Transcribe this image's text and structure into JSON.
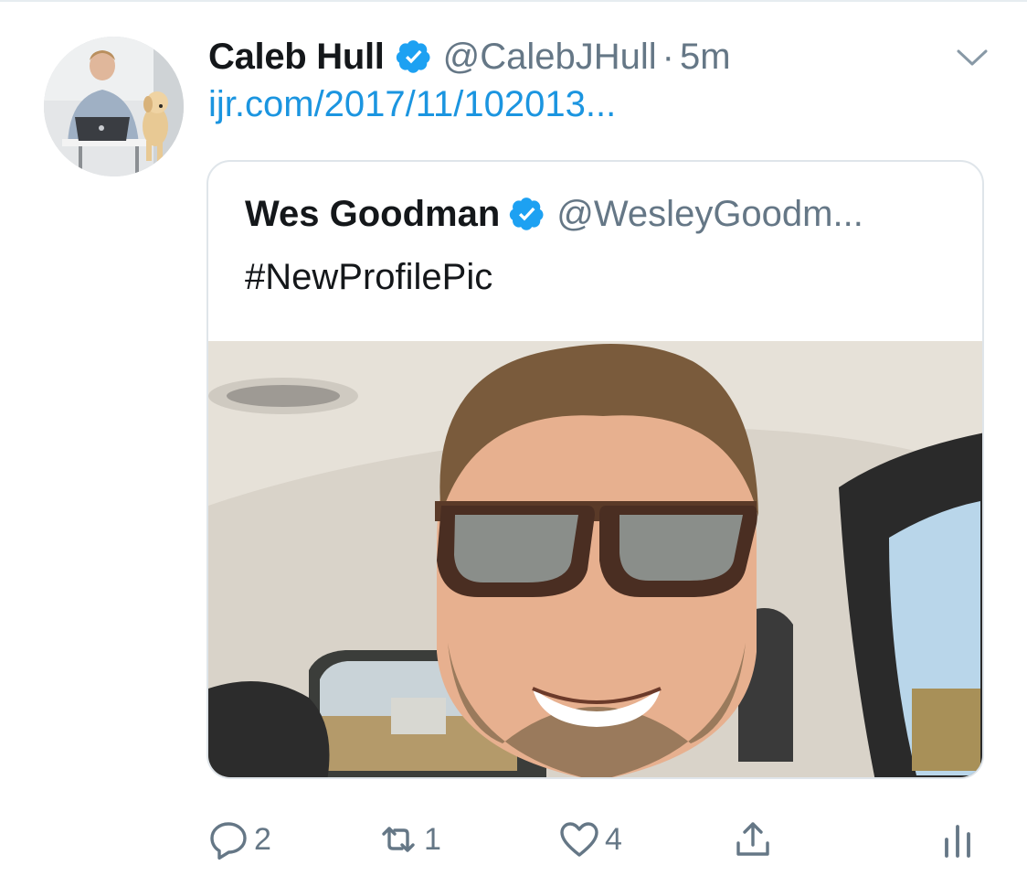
{
  "tweet": {
    "author_name": "Caleb Hull",
    "handle": "@CalebJHull",
    "separator": "·",
    "timestamp": "5m",
    "link_text": "ijr.com/2017/11/102013...",
    "verified_icon": "verified-badge-icon",
    "menu_icon": "chevron-down-icon"
  },
  "quoted_tweet": {
    "author_name": "Wes Goodman",
    "handle": "@WesleyGoodm...",
    "text": "#NewProfilePic",
    "verified_icon": "verified-badge-icon"
  },
  "actions": {
    "reply_count": "2",
    "retweet_count": "1",
    "like_count": "4",
    "reply_icon": "reply-icon",
    "retweet_icon": "retweet-icon",
    "like_icon": "heart-icon",
    "share_icon": "share-icon",
    "analytics_icon": "analytics-icon"
  },
  "colors": {
    "accent": "#1b95e0",
    "verified": "#1da1f2",
    "secondary_text": "#657786",
    "border": "#e1e8ed"
  }
}
